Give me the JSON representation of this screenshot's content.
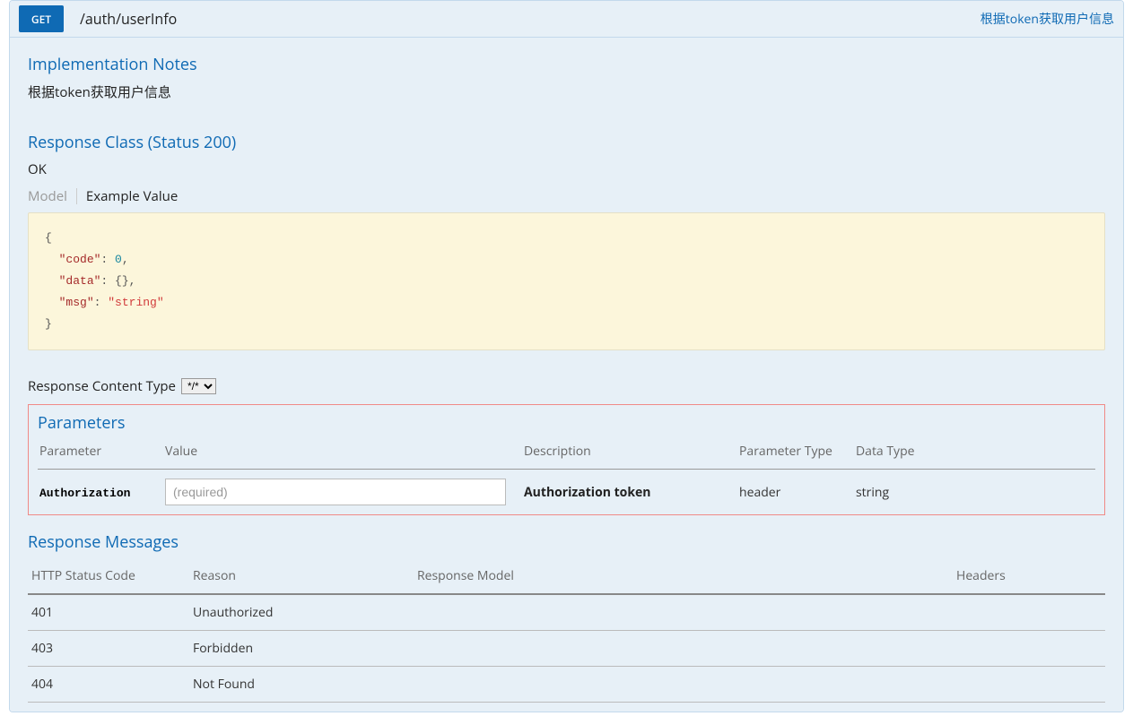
{
  "op": {
    "method": "GET",
    "path": "/auth/userInfo",
    "summary": "根据token获取用户信息"
  },
  "sections": {
    "implNotes": "Implementation Notes",
    "implNotesText": "根据token获取用户信息",
    "responseClass": "Response Class (Status 200)",
    "responseOk": "OK",
    "parameters": "Parameters",
    "responseMessages": "Response Messages"
  },
  "responseTabs": {
    "model": "Model",
    "example": "Example Value"
  },
  "exampleJson": {
    "lines": [
      "{",
      "  \"code\": 0,",
      "  \"data\": {},",
      "  \"msg\": \"string\"",
      "}"
    ],
    "code_key": "\"code\"",
    "code_val": "0",
    "data_key": "\"data\"",
    "data_val": "{}",
    "msg_key": "\"msg\"",
    "msg_val": "\"string\""
  },
  "responseContentType": {
    "label": "Response Content Type",
    "selected": "*/*"
  },
  "paramsTable": {
    "headers": {
      "parameter": "Parameter",
      "value": "Value",
      "description": "Description",
      "parameterType": "Parameter Type",
      "dataType": "Data Type"
    },
    "rows": [
      {
        "name": "Authorization",
        "placeholder": "(required)",
        "description": "Authorization token",
        "paramType": "header",
        "dataType": "string"
      }
    ]
  },
  "responseTable": {
    "headers": {
      "code": "HTTP Status Code",
      "reason": "Reason",
      "model": "Response Model",
      "headers": "Headers"
    },
    "rows": [
      {
        "code": "401",
        "reason": "Unauthorized"
      },
      {
        "code": "403",
        "reason": "Forbidden"
      },
      {
        "code": "404",
        "reason": "Not Found"
      }
    ]
  }
}
